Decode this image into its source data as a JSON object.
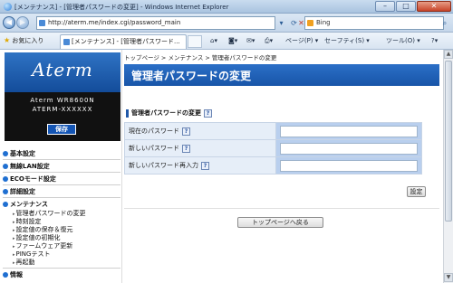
{
  "window": {
    "title": "[メンテナンス] - [管理者パスワードの変更] - Windows Internet Explorer",
    "minimize_icon": "minimize-icon",
    "maximize_icon": "maximize-icon",
    "close_icon": "close-icon"
  },
  "address": {
    "url": "http://aterm.me/index.cgi/password_main",
    "search_placeholder": "Bing"
  },
  "command_bar": {
    "favorites": "お気に入り",
    "tab_title": "[メンテナンス] - [管理者パスワード...",
    "page_menu": "ページ(P)",
    "safety_menu": "セーフティ(S)",
    "tools_menu": "ツール(O)"
  },
  "sidebar": {
    "logo": "Aterm",
    "model_name": "Aterm WR8600N",
    "model_id": "ATERM-XXXXXX",
    "save_label": "保存",
    "menu": [
      {
        "label": "基本設定"
      },
      {
        "label": "無線LAN設定"
      },
      {
        "label": "ECOモード設定"
      },
      {
        "label": "詳細設定"
      },
      {
        "label": "メンテナンス"
      }
    ],
    "sub_menu": [
      {
        "label": "管理者パスワードの変更"
      },
      {
        "label": "時刻設定"
      },
      {
        "label": "設定値の保存＆復元"
      },
      {
        "label": "設定値の初期化"
      },
      {
        "label": "ファームウェア更新"
      },
      {
        "label": "PINGテスト"
      },
      {
        "label": "再起動"
      }
    ],
    "next_label": "情報"
  },
  "main": {
    "breadcrumb": "トップページ > メンテナンス > 管理者パスワードの変更",
    "page_title": "管理者パスワードの変更",
    "section_title": "管理者パスワードの変更",
    "help_label": "?",
    "rows": [
      {
        "label": "現在のパスワード"
      },
      {
        "label": "新しいパスワード"
      },
      {
        "label": "新しいパスワード再入力"
      }
    ],
    "set_button": "設定",
    "top_button": "トップページへ戻る"
  },
  "colors": {
    "header_blue": "#1855a8",
    "label_bg": "#e6eef8",
    "field_bg": "#b9cfee"
  }
}
